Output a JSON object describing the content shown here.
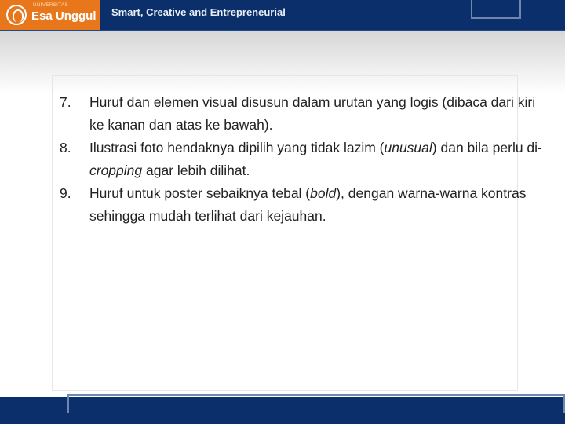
{
  "header": {
    "brand_small": "UNIVERSITAS",
    "brand_name": "Esa Unggul",
    "tagline": "Smart, Creative and Entrepreneurial"
  },
  "items": [
    {
      "number": "7.",
      "parts": [
        "Huruf dan elemen visual disusun dalam urutan yang logis (dibaca dari kiri ke kanan dan atas ke bawah)."
      ]
    },
    {
      "number": "8.",
      "pre": "Ilustrasi foto hendaknya dipilih yang tidak lazim (",
      "em": "unusual",
      "mid": ") dan bila perlu di-",
      "em2": "cropping",
      "post": " agar lebih dilihat."
    },
    {
      "number": "9.",
      "pre": "Huruf untuk poster sebaiknya tebal (",
      "em": "bold",
      "post": "), dengan warna-warna kontras sehingga mudah terlihat dari kejauhan."
    }
  ],
  "colors": {
    "header_bg": "#0a2f6b",
    "logo_bg": "#e8761b"
  }
}
